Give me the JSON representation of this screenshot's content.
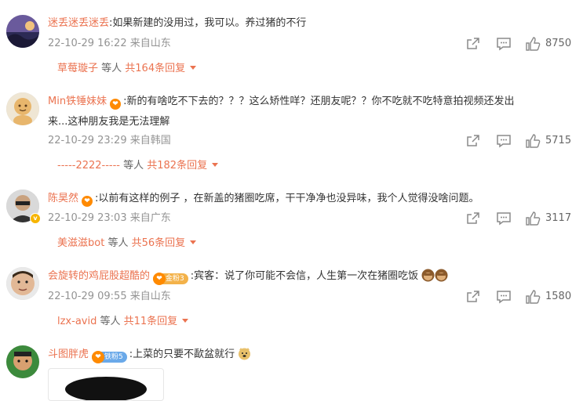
{
  "comments": [
    {
      "user": "迷丢迷丢迷丢",
      "text": ":如果新建的没用过，我可以。养过猪的不行",
      "time": "22-10-29 16:22",
      "location": "来自山东",
      "likes": "8750",
      "reply_user": "草莓璇子",
      "reply_mid": " 等人 ",
      "reply_total": "共164条回复"
    },
    {
      "user": "Min铁锤妹妹",
      "text": ":新的有啥吃不下去的？？？这么矫性咩？还朋友呢？？你不吃就不吃特意拍视频还发出",
      "text2": "来...这种朋友我是无法理解",
      "time": "22-10-29 23:29",
      "location": "来自韩国",
      "likes": "5715",
      "reply_user": "-----2222-----",
      "reply_mid": " 等人 ",
      "reply_total": "共182条回复"
    },
    {
      "user": "陈昊然",
      "text": ":以前有这样的例子 ，在新盖的猪圈吃席，干干净净也没异味，我个人觉得没啥问题。",
      "time": "22-10-29 23:03",
      "location": "来自广东",
      "likes": "3117",
      "reply_user": "美滋滋bot",
      "reply_mid": " 等人 ",
      "reply_total": "共56条回复"
    },
    {
      "user": "会旋转的鸡屁股超酷的",
      "medal": "金粉3",
      "text": ":宾客：说了你可能不会信，人生第一次在猪圈吃饭",
      "time": "22-10-29 09:55",
      "location": "来自山东",
      "likes": "1580",
      "reply_user": "lzx-avid",
      "reply_mid": " 等人 ",
      "reply_total": "共11条回复"
    },
    {
      "user": "斗图胖虎",
      "medal": "铁粉5",
      "text": ":上菜的只要不歃盆就行"
    }
  ],
  "colors": {
    "username": "#eb7350",
    "meta": "#939393",
    "fan_badge": "#ff8a00"
  },
  "icons": [
    "share-icon",
    "comment-icon",
    "like-icon",
    "chevron-down-icon",
    "monkey-emoji",
    "doge-emoji"
  ]
}
